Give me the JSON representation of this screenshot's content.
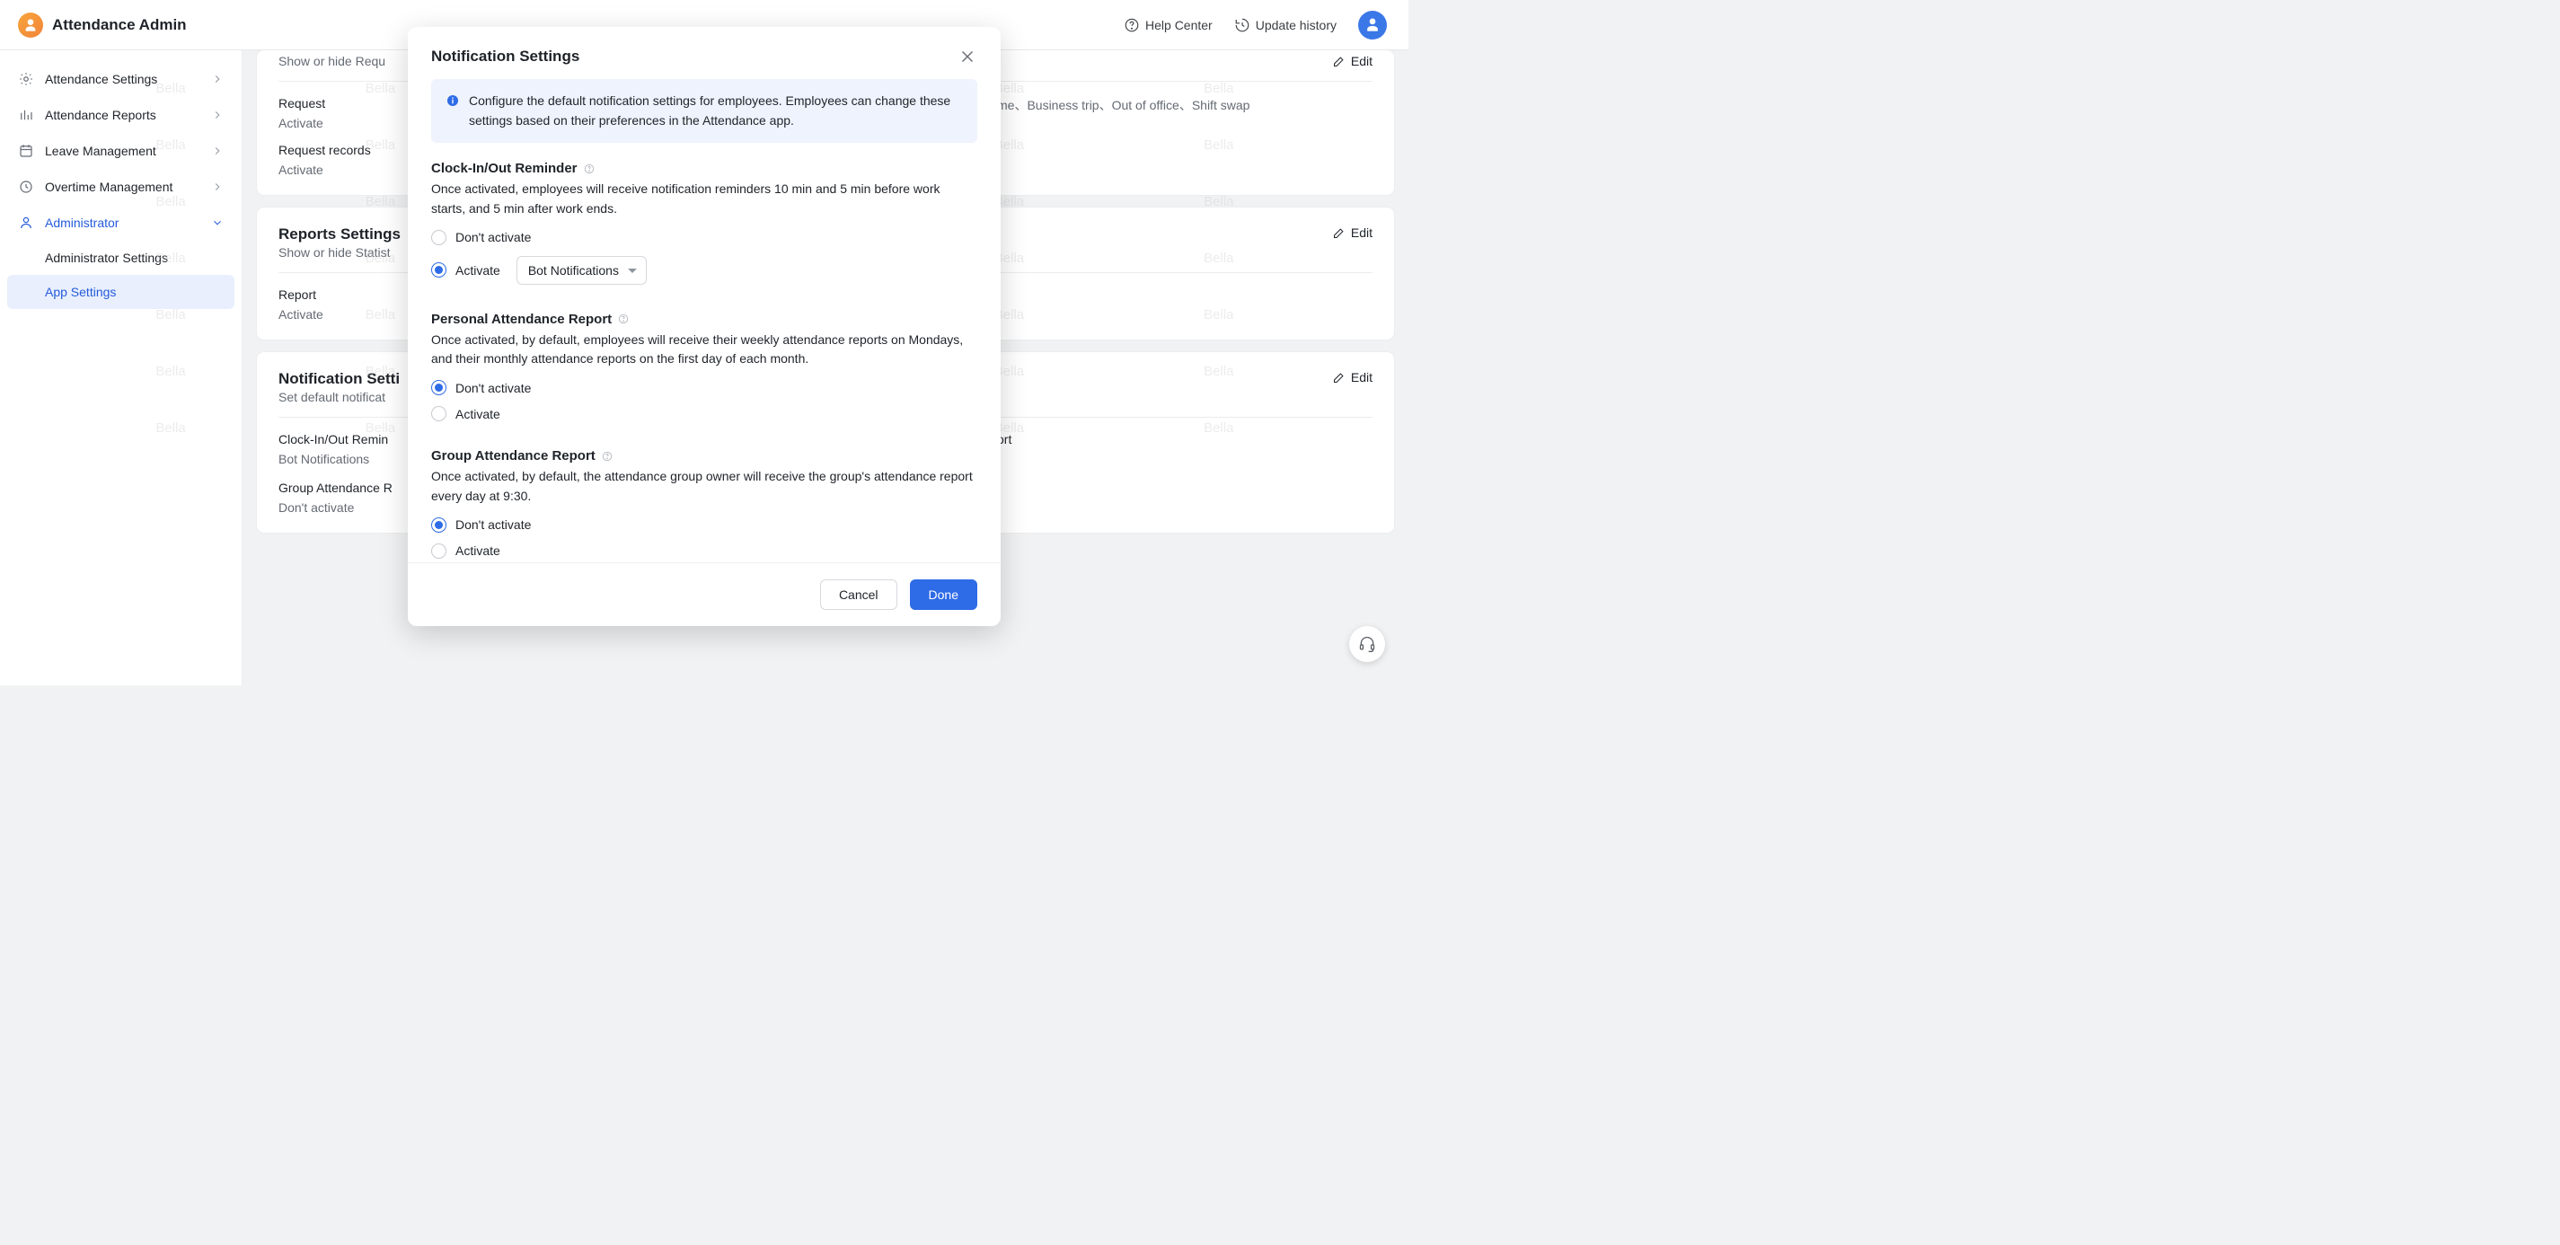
{
  "header": {
    "title": "Attendance Admin",
    "help": "Help Center",
    "history": "Update history"
  },
  "sidebar": {
    "items": [
      {
        "label": "Attendance Settings"
      },
      {
        "label": "Attendance Reports"
      },
      {
        "label": "Leave Management"
      },
      {
        "label": "Overtime Management"
      },
      {
        "label": "Administrator"
      }
    ],
    "sub": [
      {
        "label": "Administrator Settings"
      },
      {
        "label": "App Settings"
      }
    ]
  },
  "main": {
    "edit": "Edit",
    "truncated_sub": "Show or hide Requ",
    "c1": {
      "request_lbl": "Request",
      "request_val": "Activate",
      "types_val": "me、Business trip、Out of office、Shift swap",
      "records_lbl": "Request records",
      "records_val": "Activate"
    },
    "c2": {
      "title": "Reports Settings",
      "sub": "Show or hide Statist",
      "report_lbl": "Report",
      "report_val": "Activate"
    },
    "c3": {
      "title": "Notification Setti",
      "sub": "Set default notificat",
      "r1_lbl": "Clock-In/Out Remin",
      "r1_val": "Bot Notifications",
      "r2_right_lbl": "ort",
      "r3_lbl": "Group Attendance R",
      "r3_val": "Don't activate"
    }
  },
  "modal": {
    "title": "Notification Settings",
    "banner": "Configure the default notification settings for employees. Employees can change these settings based on their preferences in the Attendance app.",
    "s1": {
      "title": "Clock-In/Out Reminder",
      "desc": "Once activated, employees will receive notification reminders 10 min and 5 min before work starts, and 5 min after work ends.",
      "opt_off": "Don't activate",
      "opt_on": "Activate",
      "select_value": "Bot Notifications"
    },
    "s2": {
      "title": "Personal Attendance Report",
      "desc": "Once activated, by default, employees will receive their weekly attendance reports on Mondays, and their monthly attendance reports on the first day of each month.",
      "opt_off": "Don't activate",
      "opt_on": "Activate"
    },
    "s3": {
      "title": "Group Attendance Report",
      "desc": "Once activated, by default, the attendance group owner will receive the group's attendance report every day at 9:30.",
      "opt_off": "Don't activate",
      "opt_on": "Activate"
    },
    "cancel": "Cancel",
    "done": "Done"
  },
  "watermark": "Bella"
}
